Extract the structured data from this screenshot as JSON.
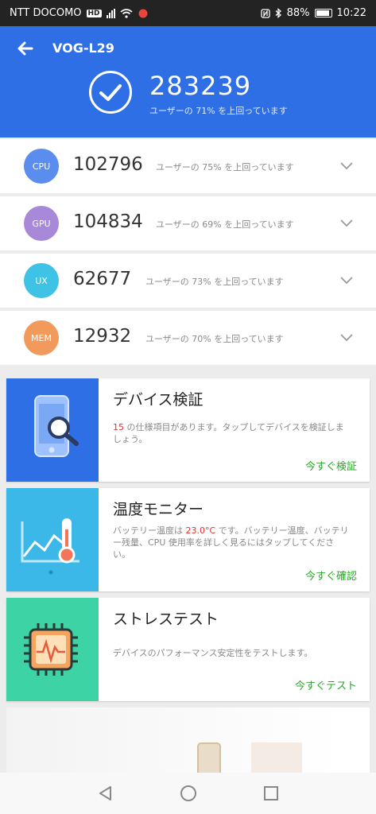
{
  "status_bar": {
    "carrier": "NTT DOCOMO",
    "hd": "HD",
    "battery_pct": "88%",
    "time": "10:22"
  },
  "header": {
    "device_name": "VOG-L29",
    "total_score": "283239",
    "total_sub": "ユーザーの 71% を上回っています",
    "accent_color": "#2f6fe6"
  },
  "scores": [
    {
      "label": "CPU",
      "score": "102796",
      "sub": "ユーザーの 75% を上回っています",
      "color": "#5b8def"
    },
    {
      "label": "GPU",
      "score": "104834",
      "sub": "ユーザーの 69% を上回っています",
      "color": "#a889d9"
    },
    {
      "label": "UX",
      "score": "62677",
      "sub": "ユーザーの 73% を上回っています",
      "color": "#3ec3e6"
    },
    {
      "label": "MEM",
      "score": "12932",
      "sub": "ユーザーの 70% を上回っています",
      "color": "#f19a5b"
    }
  ],
  "cards": {
    "verify": {
      "title": "デバイス検証",
      "count": "15",
      "desc": " の仕様項目があります。タップしてデバイスを検証しましょう。",
      "action": "今すぐ検証",
      "color": "#2f6fe6"
    },
    "monitor": {
      "title": "温度モニター",
      "desc_pre": "バッテリー温度は ",
      "temp": "23.0°C",
      "desc_post": " です。バッテリー温度、バッテリー残量、CPU 使用率を詳しく見るにはタップしてください。",
      "action": "今すぐ確認",
      "color": "#3bb7e8"
    },
    "stress": {
      "title": "ストレステスト",
      "desc": "デバイスのパフォーマンス安定性をテストします。",
      "action": "今すぐテスト",
      "color": "#3ed3a4"
    }
  }
}
